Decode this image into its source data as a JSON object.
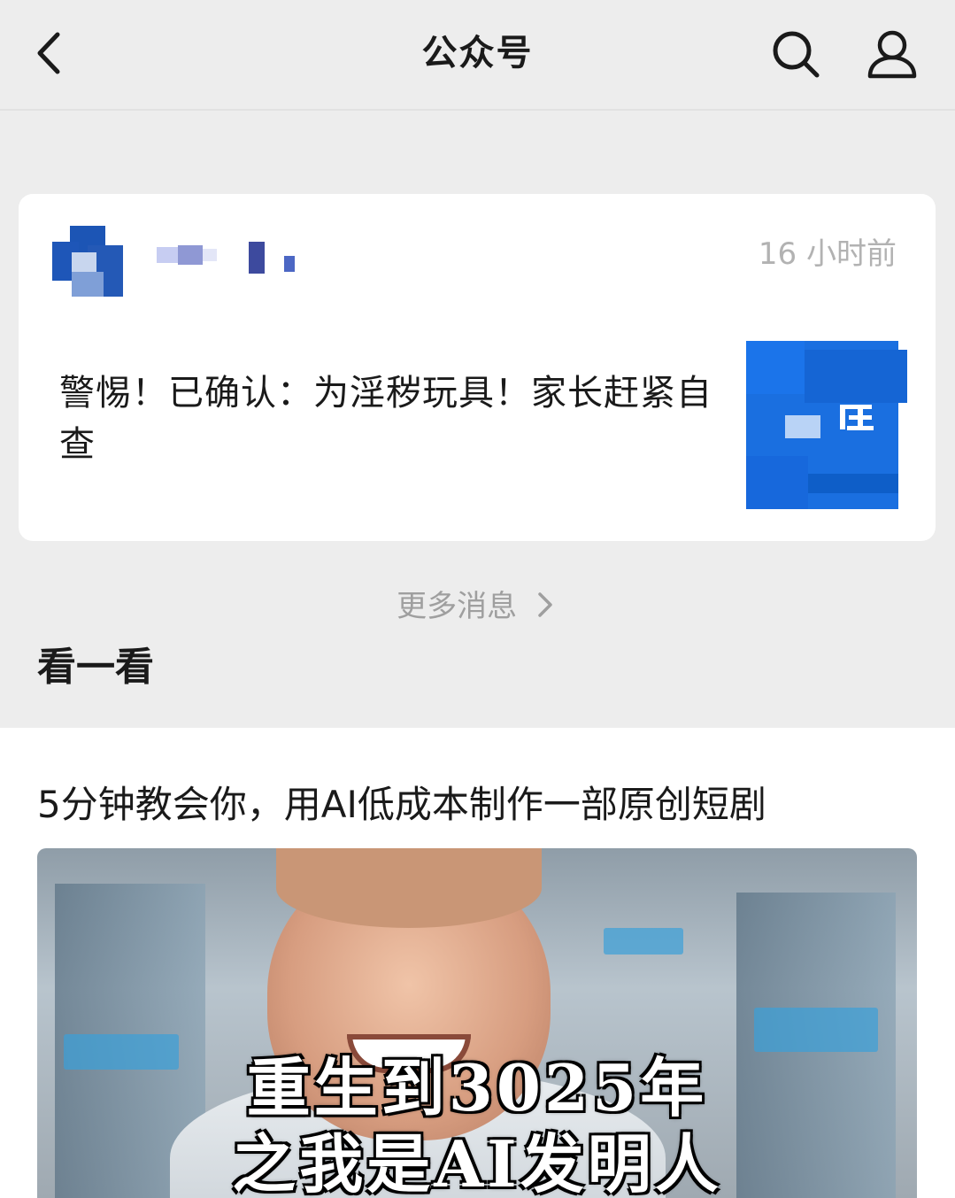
{
  "header": {
    "title": "公众号",
    "back_icon": "chevron-left-icon",
    "search_icon": "search-icon",
    "profile_icon": "person-icon"
  },
  "message_card": {
    "time": "16 小时前",
    "headline": "警惕！已确认：为淫秽玩具！家长赶紧自查"
  },
  "more_messages": {
    "label": "更多消息"
  },
  "section": {
    "title": "看一看"
  },
  "feed": {
    "article_title": "5分钟教会你，用AI低成本制作一部原创短剧",
    "cover_caption_line1": "重生到3025年",
    "cover_caption_line2": "之我是AI发明人"
  },
  "colors": {
    "page_bg": "#ededed",
    "card_bg": "#ffffff",
    "muted_text": "#b2b2b2",
    "accent_blue": "#1a6fe0"
  }
}
